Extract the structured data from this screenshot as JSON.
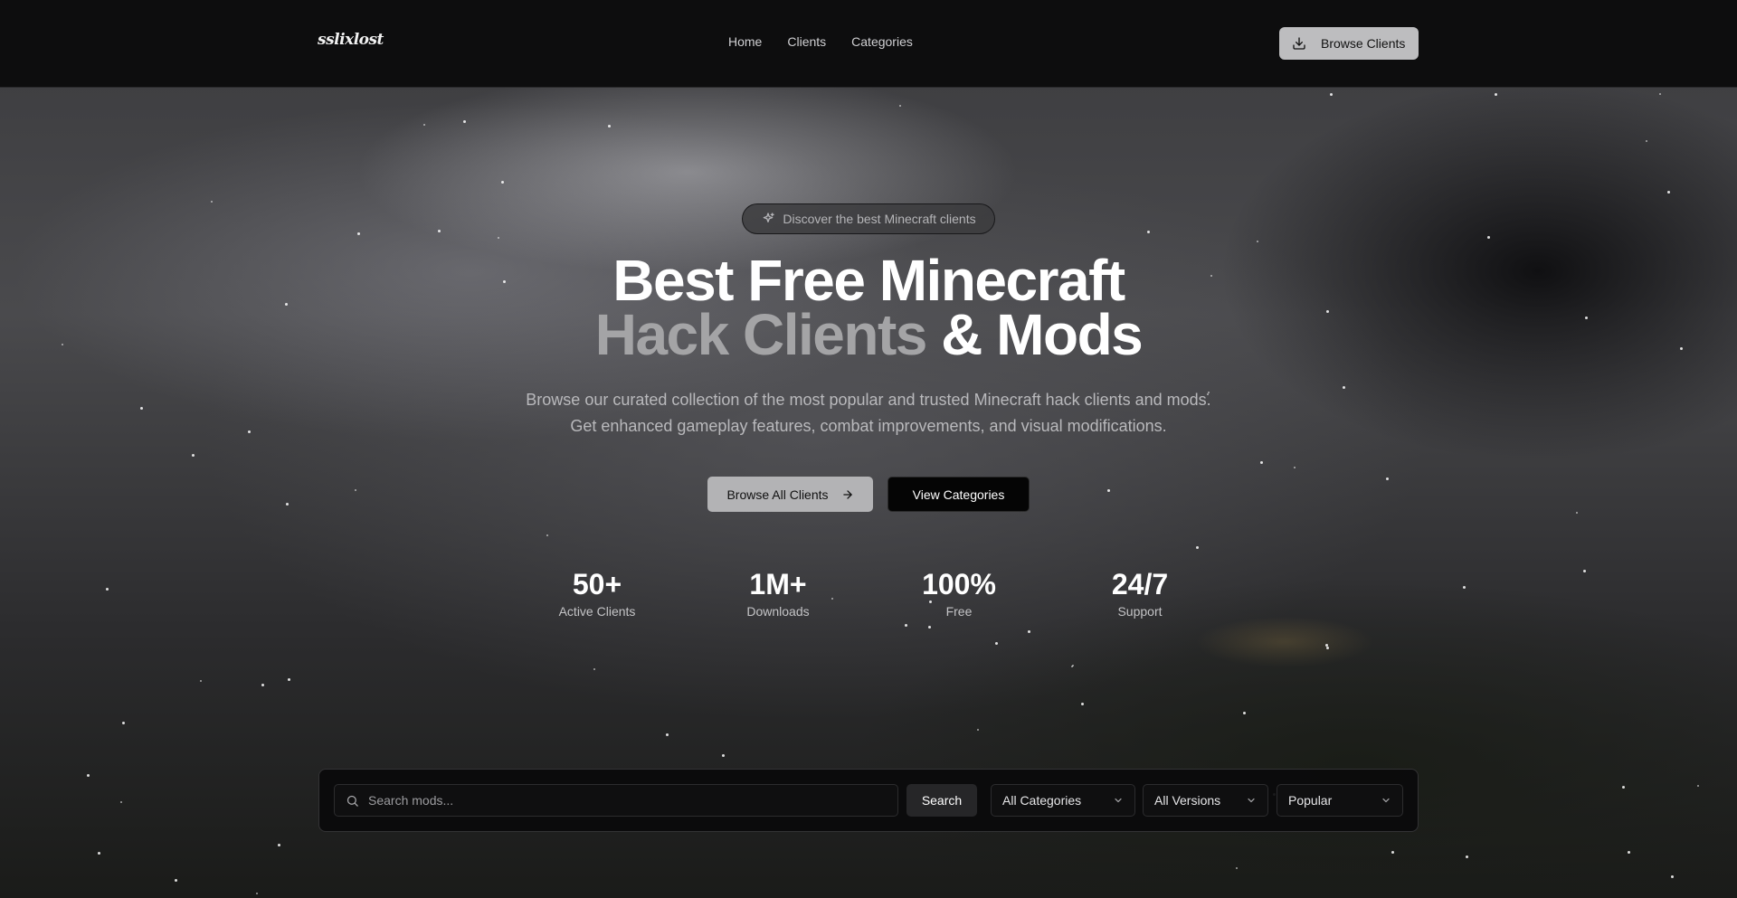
{
  "header": {
    "logo": "sslixlost",
    "nav": [
      "Home",
      "Clients",
      "Categories"
    ],
    "browse_button": "Browse Clients"
  },
  "hero": {
    "badge": "Discover the best Minecraft clients",
    "title_line1": "Best Free Minecraft",
    "title_line2_dim": "Hack Clients",
    "title_line2_bright": "& Mods",
    "subtitle": "Browse our curated collection of the most popular and trusted Minecraft hack clients and mods. Get enhanced gameplay features, combat improvements, and visual modifications.",
    "primary_button": "Browse All Clients",
    "secondary_button": "View Categories"
  },
  "stats": [
    {
      "value": "50+",
      "label": "Active Clients"
    },
    {
      "value": "1M+",
      "label": "Downloads"
    },
    {
      "value": "100%",
      "label": "Free"
    },
    {
      "value": "24/7",
      "label": "Support"
    }
  ],
  "filters": {
    "search_placeholder": "Search mods...",
    "search_button": "Search",
    "category": "All Categories",
    "version": "All Versions",
    "sort": "Popular"
  }
}
